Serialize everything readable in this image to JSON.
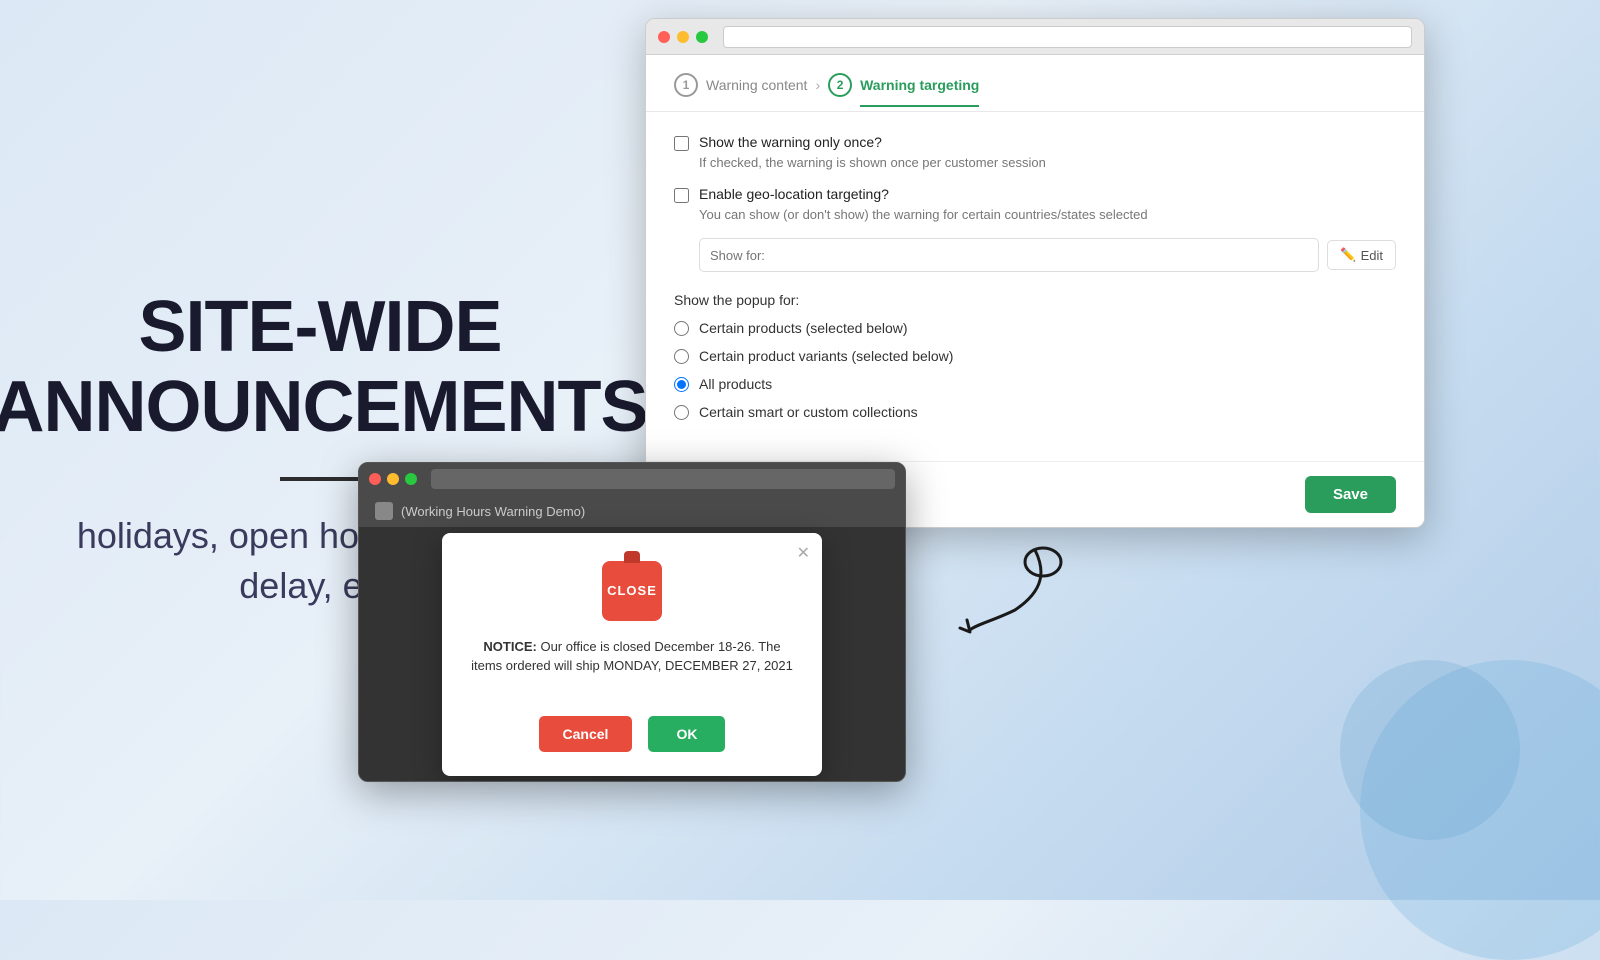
{
  "left": {
    "title_line1": "SITE-WIDE",
    "title_line2": "ANNOUNCEMENTS",
    "subtitle": "holidays, open hours, shipping delay, etc."
  },
  "browser_main": {
    "stepper": {
      "step1": {
        "number": "1",
        "label": "Warning content",
        "state": "inactive"
      },
      "step2": {
        "number": "2",
        "label": "Warning targeting",
        "state": "active"
      }
    },
    "form": {
      "show_once_label": "Show the warning only once?",
      "show_once_helper": "If checked, the warning is shown once per customer session",
      "geo_label": "Enable geo-location targeting?",
      "geo_helper": "You can show (or don't show) the warning for certain countries/states selected",
      "show_for_placeholder": "Show for:",
      "edit_label": "Edit",
      "popup_for_label": "Show the popup for:",
      "radio_options": [
        "Certain products (selected below)",
        "Certain product variants (selected below)",
        "All products",
        "Certain smart or custom collections"
      ],
      "selected_radio_index": 2
    },
    "save_label": "Save"
  },
  "browser_demo": {
    "header_text": "(Working Hours Warning Demo)",
    "modal": {
      "close_sign_text": "CLOSE",
      "notice_bold": "NOTICE:",
      "notice_text": " Our office is closed December 18-26. The items ordered will ship MONDAY, DECEMBER 27, 2021",
      "cancel_label": "Cancel",
      "ok_label": "OK"
    }
  }
}
